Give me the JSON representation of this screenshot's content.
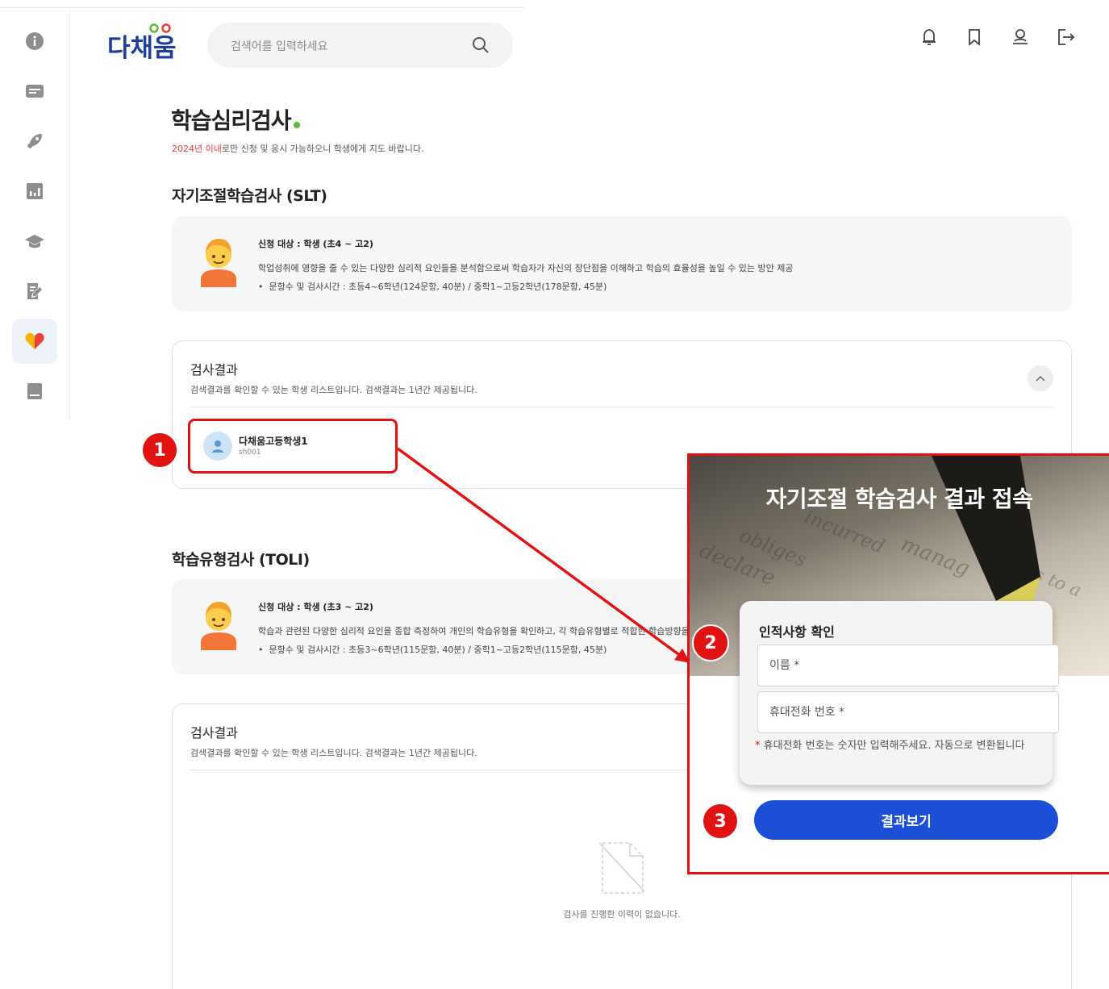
{
  "app": {
    "logo_text": "다채움",
    "brand_colors": {
      "primary_blue": "#1a4fd6",
      "accent_red": "#e01212",
      "logo_green": "#5db83a"
    }
  },
  "search": {
    "placeholder": "검색어를 입력하세요",
    "icon": "search-icon"
  },
  "header_icons": [
    "bell-icon",
    "bookmark-icon",
    "user-icon",
    "logout-icon"
  ],
  "sidebar": {
    "items": [
      {
        "icon": "info-icon",
        "active": false
      },
      {
        "icon": "card-icon",
        "active": false
      },
      {
        "icon": "rocket-icon",
        "active": false
      },
      {
        "icon": "chart-icon",
        "active": false
      },
      {
        "icon": "graduation-cap-icon",
        "active": false
      },
      {
        "icon": "edit-note-icon",
        "active": false
      },
      {
        "icon": "heart-icon",
        "active": true
      },
      {
        "icon": "book-icon",
        "active": false
      }
    ]
  },
  "page": {
    "title": "학습심리검사",
    "notice_red": "2024년 이내",
    "notice_rest": "로만 신청 및 응시 가능하오니 학생에게 지도 바랍니다."
  },
  "slt": {
    "title": "자기조절학습검사 (SLT)",
    "target": "신청 대상 : 학생 (초4 ~ 고2)",
    "desc": "학업성취에 영향을 줄 수 있는 다양한 심리적 요인들을 분석함으로써 학습자가 자신의 장단점을 이해하고 학습의 효율성을 높일 수 있는 방안 제공",
    "bullet": "문항수 및 검사시간 : 초등4~6학년(124문항, 40분) / 중학1~고등2학년(178문항, 45분)",
    "result": {
      "title": "검사결과",
      "desc": "검색결과를 확인할 수 있는 학생 리스트입니다. 검색결과는 1년간 제공됩니다.",
      "students": [
        {
          "name": "다채움고등학생1",
          "id": "sh001"
        }
      ]
    }
  },
  "toli": {
    "title": "학습유형검사 (TOLI)",
    "target": "신청 대상 : 학생 (초3 ~ 고2)",
    "desc": "학습과 관련된 다양한 심리적 요인을 종합 측정하여 개인의 학습유형을 확인하고, 각 학습유형별로 적합한 학습방향을",
    "bullet": "문항수 및 검사시간 : 초등3~6학년(115문항, 40분) / 중학1~고등2학년(115문항, 45분)",
    "result": {
      "title": "검사결과",
      "desc": "검색결과를 확인할 수 있는 학생 리스트입니다. 검색결과는 1년간 제공됩니다.",
      "empty_text": "검사를 진행한 이력이 없습니다."
    }
  },
  "badges": {
    "one": "1",
    "two": "2",
    "three": "3"
  },
  "popup": {
    "title": "자기조절 학습검사 결과 접속",
    "card_title": "인적사항 확인",
    "name_placeholder": "이름 *",
    "phone_placeholder": "휴대전화 번호 *",
    "note_star": "*",
    "note": " 휴대전화 번호는 숫자만 입력해주세요. 자동으로 변환됩니다",
    "button": "결과보기"
  }
}
